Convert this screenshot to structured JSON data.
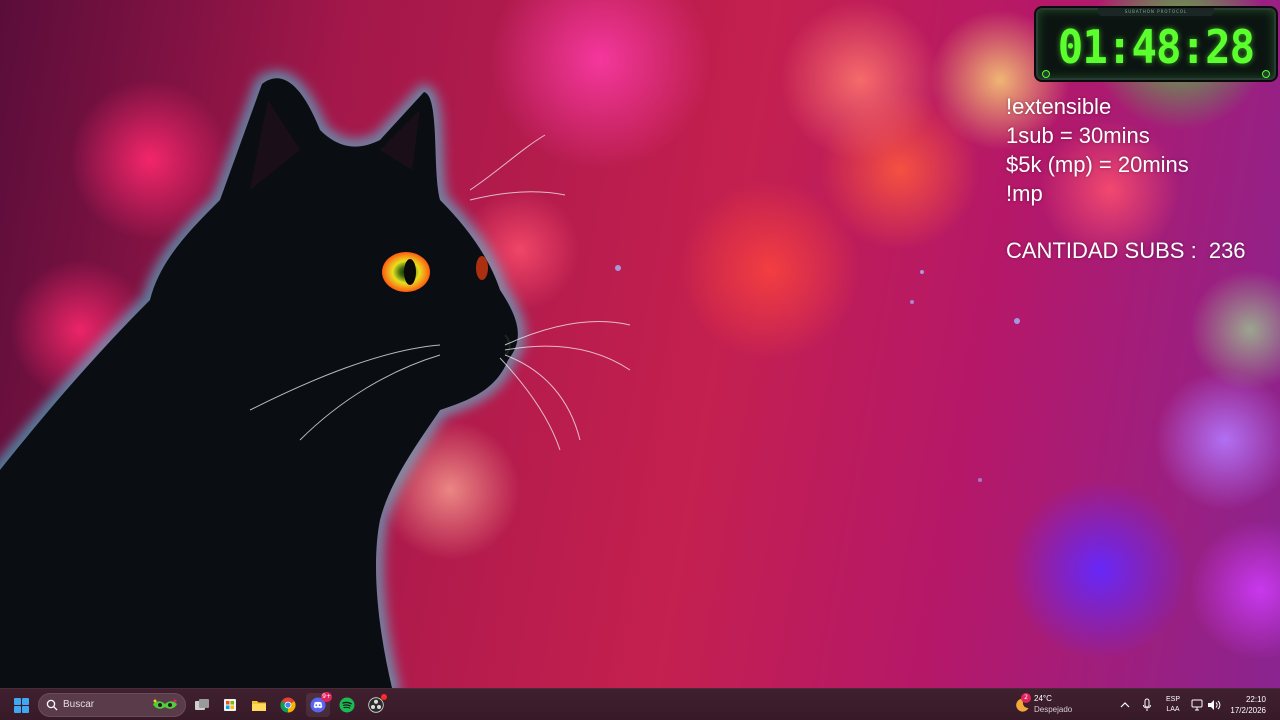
{
  "desktop": {
    "wallpaper": "black cat with bokeh background"
  },
  "overlay": {
    "timer_header": "SUBATHON PROTOCOL",
    "timer_value": "01:48:28",
    "timer_color": "#5cff2e",
    "lines": [
      "!extensible",
      "1sub = 30mins",
      "$5k (mp) = 20mins",
      "!mp"
    ],
    "subs_label": "CANTIDAD SUBS :",
    "subs_count": "236"
  },
  "taskbar": {
    "start_icon": "windows-start-icon",
    "search_placeholder": "Buscar",
    "apps": [
      {
        "name": "task-view-icon"
      },
      {
        "name": "store-icon"
      },
      {
        "name": "file-explorer-icon"
      },
      {
        "name": "chrome-icon"
      },
      {
        "name": "discord-icon",
        "badge": "9+"
      },
      {
        "name": "spotify-icon"
      },
      {
        "name": "obs-icon"
      }
    ],
    "weather": {
      "badge": "2",
      "temp": "24°C",
      "condition": "Despejado"
    },
    "language": {
      "line1": "ESP",
      "line2": "LAA"
    },
    "clock": {
      "time": "22:10",
      "date": "17/2/2026"
    }
  }
}
